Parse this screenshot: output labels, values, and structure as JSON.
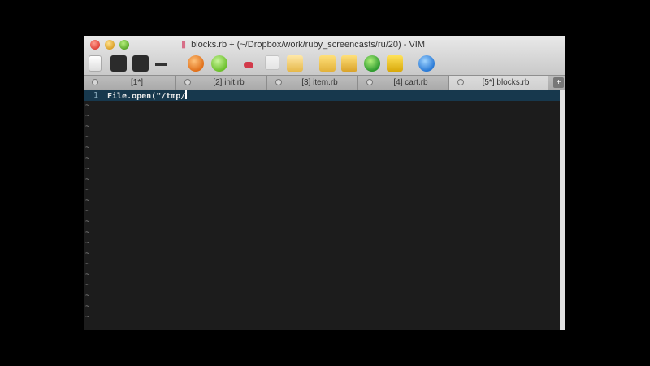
{
  "window": {
    "title": "blocks.rb + (~/Dropbox/work/ruby_screencasts/ru/20) - VIM",
    "doc_icon": "document-icon"
  },
  "toolbar": {
    "icons": [
      "open-file-icon",
      "save-icon",
      "save-all-icon",
      "separator-icon",
      "undo-icon",
      "redo-icon",
      "cut-icon",
      "copy-icon",
      "paste-icon",
      "find-icon",
      "replace-icon",
      "run-icon",
      "build-icon",
      "help-icon"
    ]
  },
  "tabs": [
    {
      "label": "[1*]"
    },
    {
      "label": "[2] init.rb"
    },
    {
      "label": "[3] item.rb"
    },
    {
      "label": "[4] cart.rb"
    },
    {
      "label": "[5*] blocks.rb"
    }
  ],
  "tab_plus": "+",
  "editor": {
    "line_number": "1",
    "code": "File.open(\"/tmp/",
    "tilde": "~",
    "tilde_count_note": ""
  },
  "colors": {
    "editor_bg": "#1c1c1c",
    "current_line_bg": "#17384d",
    "text": "#e8e8e8"
  }
}
